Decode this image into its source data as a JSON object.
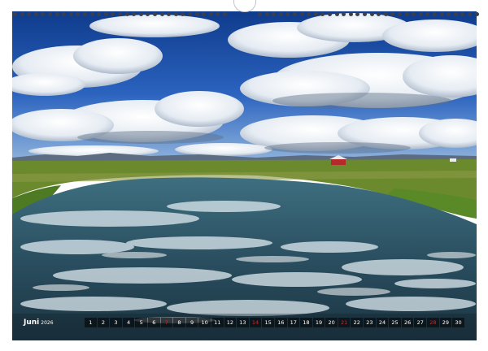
{
  "calendar": {
    "month": "Juni",
    "year": "2026",
    "days": [
      "1",
      "2",
      "3",
      "4",
      "5",
      "6",
      "7",
      "8",
      "9",
      "10",
      "11",
      "12",
      "13",
      "14",
      "15",
      "16",
      "17",
      "18",
      "19",
      "20",
      "21",
      "22",
      "23",
      "24",
      "25",
      "26",
      "27",
      "28",
      "29",
      "30"
    ],
    "sundays": [
      7,
      14,
      21,
      28
    ],
    "sunday_color": "#e02020",
    "day_text_color": "#ffffff"
  },
  "photo": {
    "subject": "landscape-photo"
  },
  "colors": {
    "sky": "#1f4fa8",
    "water": "#2c4e5e",
    "grass": "#6b8a2e"
  }
}
